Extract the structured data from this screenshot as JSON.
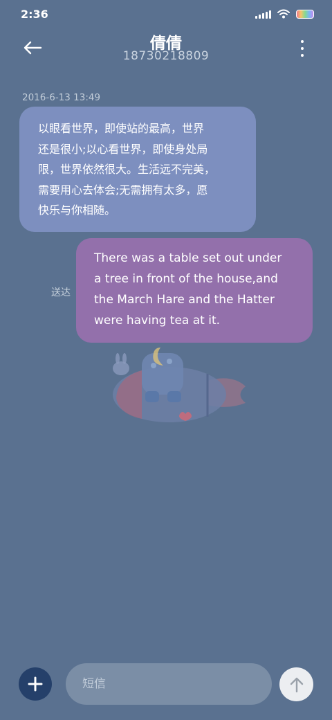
{
  "status_bar": {
    "time": "2:36",
    "icons": [
      "signal-icon",
      "wifi-icon",
      "battery-icon"
    ]
  },
  "header": {
    "contact_name": "倩倩",
    "phone_number": "18730218809",
    "back_icon": "arrow-left-icon",
    "menu_icon": "more-vertical-icon"
  },
  "conversation": {
    "timestamp": "2016-6-13 13:49",
    "messages": [
      {
        "direction": "incoming",
        "lines": [
          "以眼看世界，即使站的最高，世界",
          "还是很小;以心看世界，即使身处局",
          "限，世界依然很大。生活远不完美，",
          "需要用心去体会;无需拥有太多，愿",
          "快乐与你相随。"
        ]
      },
      {
        "direction": "outgoing",
        "status": "送达",
        "lines": [
          "There was a table set out under",
          "a tree in front of the house,and",
          "the March Hare and the Hatter",
          "were having tea at it."
        ]
      }
    ]
  },
  "composer": {
    "add_icon": "plus-icon",
    "placeholder": "短信",
    "value": "",
    "send_icon": "arrow-up-icon"
  },
  "colors": {
    "background": "#5a7190",
    "incoming_bubble": "#7d8fbf",
    "outgoing_bubble": "#9370ab",
    "add_button": "#25406a"
  }
}
